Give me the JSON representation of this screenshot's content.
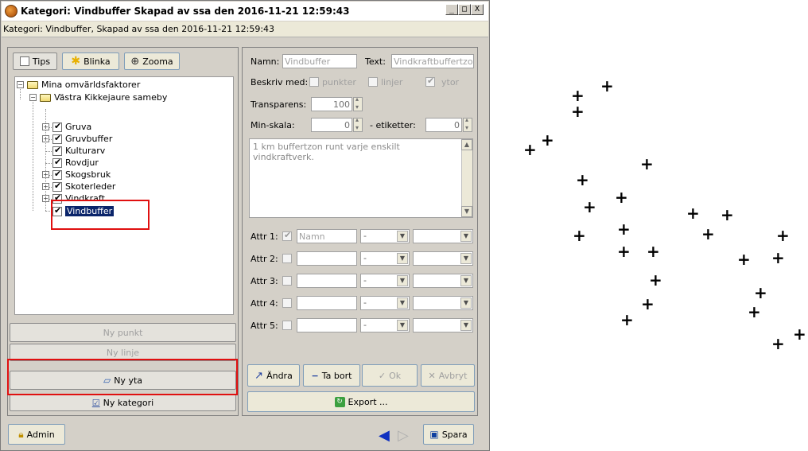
{
  "window": {
    "title": "Kategori: Vindbuffer Skapad av ssa den 2016-11-21 12:59:43",
    "subheader": "Kategori: Vindbuffer, Skapad av ssa den 2016-11-21 12:59:43",
    "controls": [
      "_",
      "□",
      "X"
    ]
  },
  "left_toolbar": {
    "tips_label": "Tips",
    "blinka_label": "Blinka",
    "zooma_label": "Zooma"
  },
  "tree": {
    "root": "Mina omvärldsfaktorer",
    "group": "Västra Kikkejaure sameby",
    "items": [
      {
        "label": "Gruva",
        "expandable": true
      },
      {
        "label": "Gruvbuffer",
        "expandable": true
      },
      {
        "label": "Kulturarv",
        "expandable": false
      },
      {
        "label": "Rovdjur",
        "expandable": false
      },
      {
        "label": "Skogsbruk",
        "expandable": true
      },
      {
        "label": "Skoterleder",
        "expandable": true
      },
      {
        "label": "Vindkraft",
        "expandable": true
      },
      {
        "label": "Vindbuffer",
        "expandable": false,
        "selected": true
      }
    ]
  },
  "left_buttons": {
    "ny_punkt": "Ny punkt",
    "ny_linje": "Ny linje",
    "ny_yta": "Ny yta",
    "ny_kategori": "Ny kategori"
  },
  "form": {
    "namn_label": "Namn:",
    "namn_value": "Vindbuffer",
    "text_label": "Text:",
    "text_value": "Vindkraftbuffertzo",
    "beskriv_label": "Beskriv med:",
    "punkter_label": "punkter",
    "linjer_label": "linjer",
    "ytor_label": "ytor",
    "transparens_label": "Transparens:",
    "transparens_value": "100",
    "minskala_label": "Min-skala:",
    "minskala_value": "0",
    "etiketter_label": "- etiketter:",
    "etiketter_value": "0",
    "description": "1 km buffertzon runt varje enskilt\nvindkraftverk.",
    "attrs": [
      {
        "label": "Attr 1:",
        "checked": true,
        "value": "Namn",
        "combo": "-"
      },
      {
        "label": "Attr 2:",
        "checked": false,
        "value": "",
        "combo": "-"
      },
      {
        "label": "Attr 3:",
        "checked": false,
        "value": "",
        "combo": "-"
      },
      {
        "label": "Attr 4:",
        "checked": false,
        "value": "",
        "combo": "-"
      },
      {
        "label": "Attr 5:",
        "checked": false,
        "value": "",
        "combo": "-"
      }
    ]
  },
  "right_buttons": {
    "andra": "Ändra",
    "ta_bort": "Ta bort",
    "ok": "Ok",
    "avbryt": "Avbryt",
    "export": "Export ..."
  },
  "bottom": {
    "admin": "Admin",
    "spara": "Spara"
  },
  "colors": {
    "selection": "#0a246a",
    "highlight": "#e01010",
    "window_bg": "#d4d0c8"
  }
}
